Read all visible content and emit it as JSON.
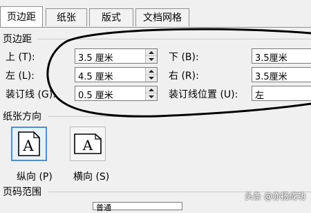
{
  "tabs": [
    "页边距",
    "纸张",
    "版式",
    "文档网格"
  ],
  "margins": {
    "title": "页边距",
    "top_label": "上 (T):",
    "top_value": "3.5 厘米",
    "bottom_label": "下 (B):",
    "bottom_value": "3.5厘米",
    "left_label": "左 (L):",
    "left_value": "4.5 厘米",
    "right_label": "右 (R):",
    "right_value": "3.5厘米",
    "gutter_label": "装订线 (G):",
    "gutter_value": "0.5 厘米",
    "gutter_pos_label": "装订线位置 (U):",
    "gutter_pos_value": "左"
  },
  "orientation": {
    "title": "纸张方向",
    "portrait_label": "纵向 (P)",
    "landscape_label": "横向 (S)",
    "icon_letter": "A"
  },
  "pages": {
    "title": "页码范围",
    "partial_field_value": "普通"
  },
  "watermark": "头条 @亦扬成功",
  "colors": {
    "annotation": "#000000",
    "selected_border": "#4a90d9"
  }
}
